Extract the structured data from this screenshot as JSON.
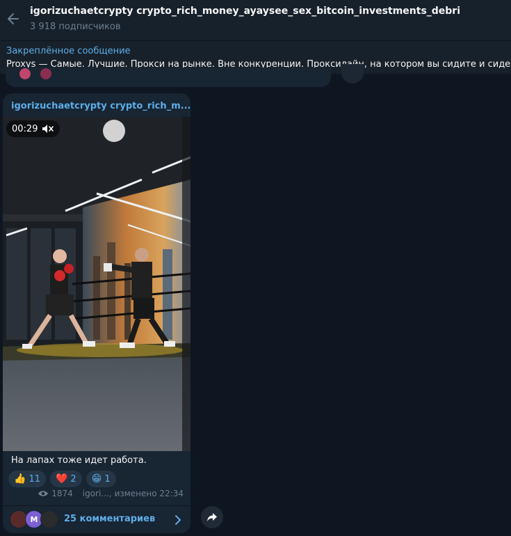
{
  "header": {
    "title": "igorizuchaetcrypty crypto_rich_money_ayaysee_sex_bitcoin_investments_debri",
    "subscribers": "3 918 подписчиков",
    "back_icon": "arrow-left-icon"
  },
  "pinned": {
    "title": "Закреплённое сообщение",
    "text": "Proxys — Самые. Лучшие. Прокси на рынке. Вне конкуренции. Проксилайн, на котором вы сидите и сиде"
  },
  "message": {
    "author": "igorizuchaetcrypty crypto_rich_m...",
    "video_duration": "00:29",
    "muted_icon": "speaker-muted-icon",
    "caption": "На лапах тоже идет работа.",
    "reactions": [
      {
        "emoji": "👍",
        "count": "11"
      },
      {
        "emoji": "❤️",
        "count": "2"
      },
      {
        "emoji": "😁",
        "count": "1"
      }
    ],
    "views": "1874",
    "signature": "igori...,",
    "edited_time": "изменено 22:34",
    "comments": "25 комментариев",
    "avatar_initial": "M"
  },
  "colors": {
    "background": "#0e1621",
    "header": "#17212b",
    "bubble": "#182533",
    "accent": "#5eaee9",
    "muted_text": "#6d7f8f"
  }
}
